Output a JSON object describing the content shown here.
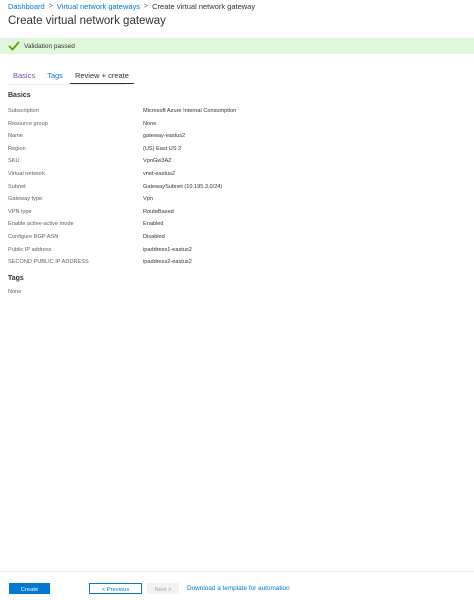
{
  "breadcrumb": {
    "items": [
      "Dashboard",
      "Virtual network gateways",
      "Create virtual network gateway"
    ],
    "separator": ">"
  },
  "page": {
    "title": "Create virtual network gateway"
  },
  "validation": {
    "message": "Validation passed",
    "status_color": "#dff6dd",
    "icon": "checkmark-icon",
    "icon_color": "#57a300"
  },
  "tabs": [
    {
      "label": "Basics",
      "active": false
    },
    {
      "label": "Tags",
      "active": false
    },
    {
      "label": "Review + create",
      "active": true
    }
  ],
  "basics": {
    "title": "Basics",
    "rows": [
      {
        "label": "Subscription",
        "value": "Microsoft Azure Internal Consumption"
      },
      {
        "label": "Resource group",
        "value": "None"
      },
      {
        "label": "Name",
        "value": "gateway-eastus2"
      },
      {
        "label": "Region",
        "value": "(US) East US 2"
      },
      {
        "label": "SKU",
        "value": "VpnGw3AZ"
      },
      {
        "label": "Virtual network",
        "value": "vnet-eastus2"
      },
      {
        "label": "Subnet",
        "value": "GatewaySubnet (10.195.3.0/24)"
      },
      {
        "label": "Gateway type",
        "value": "Vpn"
      },
      {
        "label": "VPN type",
        "value": "RouteBased"
      },
      {
        "label": "Enable active-active mode",
        "value": "Enabled"
      },
      {
        "label": "Configure BGP ASN",
        "value": "Disabled"
      },
      {
        "label": "Public IP address",
        "value": "ipaddress1-eastus2"
      },
      {
        "label": "SECOND PUBLIC IP ADDRESS",
        "value": "ipaddress2-eastus2"
      }
    ]
  },
  "tags_section": {
    "title": "Tags",
    "value": "None"
  },
  "footer": {
    "create_label": "Create",
    "previous_label": "< Previous",
    "next_label": "Next >",
    "download_link": "Download a template for automation"
  },
  "colors": {
    "accent": "#0078d4",
    "visited_link": "#7b45a6"
  }
}
